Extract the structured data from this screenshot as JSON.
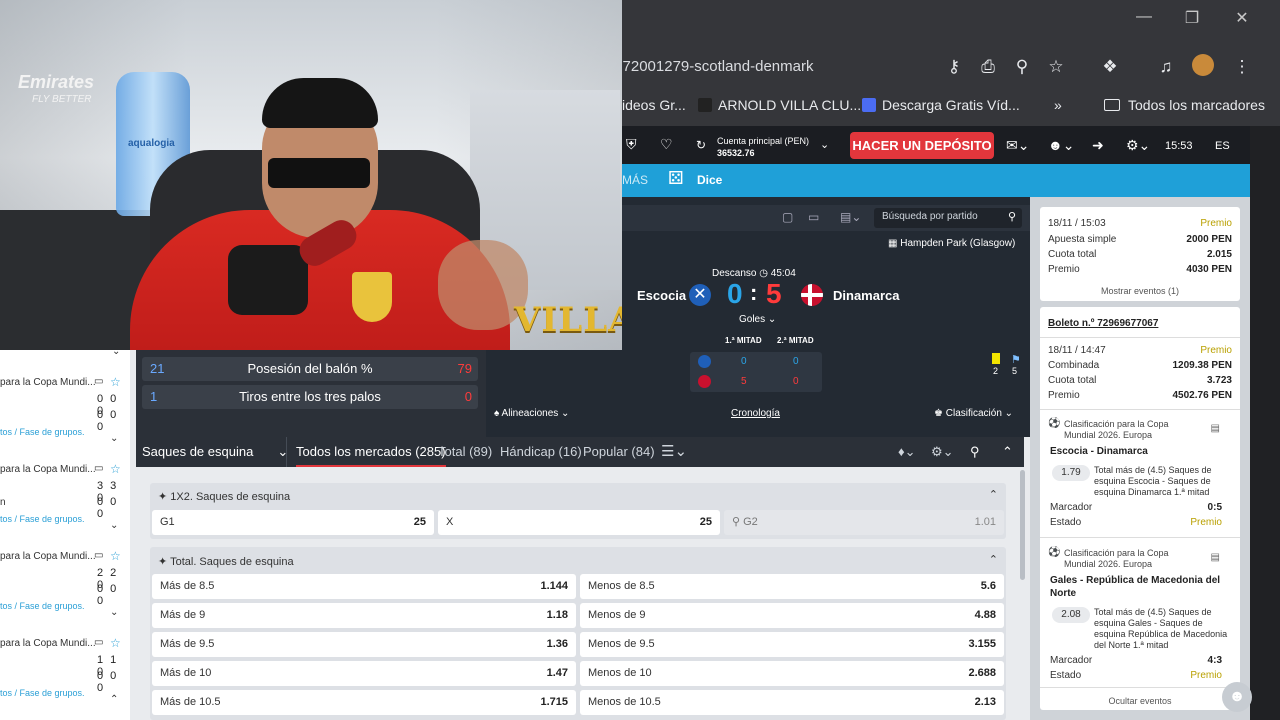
{
  "browser": {
    "url": "/672001279-scotland-denmark",
    "bookmarks": [
      "ideos Gr...",
      "ARNOLD VILLA CLU...",
      "Descarga Gratis Víd..."
    ],
    "bookmarks_folder": "Todos los marcadores"
  },
  "site_header": {
    "account_label": "Cuenta principal (PEN)",
    "balance": "36532.76",
    "deposit_label": "HACER UN DEPÓSITO",
    "time": "15:53",
    "lang": "ES",
    "nav_more": "MÁS",
    "nav_dice": "Dice"
  },
  "event": {
    "search_placeholder": "Búsqueda por partido",
    "venue": "Hampden Park (Glasgow)",
    "status": "Descanso",
    "clock": "45:04",
    "home_team": "Escocia",
    "away_team": "Dinamarca",
    "home_score": "0",
    "separator": ":",
    "away_score": "5",
    "goals_label": "Goles",
    "first_half": "1.ª MITAD",
    "second_half": "2.ª MITAD",
    "home_h1": "0",
    "home_h2": "0",
    "away_h1": "5",
    "away_h2": "0",
    "yellow_cards": "2",
    "corners": "5",
    "lineups": "Alineaciones",
    "timeline": "Cronología",
    "standings": "Clasificación"
  },
  "stats": [
    {
      "home": "21",
      "label": "Posesión del balón %",
      "away": "79"
    },
    {
      "home": "1",
      "label": "Tiros entre los tres palos",
      "away": "0"
    }
  ],
  "market_tabs": {
    "selector": "Saques de esquina",
    "all": "Todos los mercados (285)",
    "total": "Total (89)",
    "handicap": "Hándicap (16)",
    "popular": "Popular (84)"
  },
  "left_list": [
    {
      "title": "para la Copa Mundi...",
      "r1": "0 0 0",
      "r2": "0 0 0",
      "link": "tos / Fase de grupos."
    },
    {
      "title": "para la Copa Mundi...",
      "r1": "3 3 0",
      "r2": "0 0 0",
      "name": "n",
      "link": "tos / Fase de grupos."
    },
    {
      "title": "para la Copa Mundi...",
      "r1": "2 2 0",
      "r2": "0 0 0",
      "link": "tos / Fase de grupos."
    },
    {
      "title": "para la Copa Mundi...",
      "r1": "1 1 0",
      "r2": "0 0 0",
      "link": "tos / Fase de grupos."
    }
  ],
  "market_1x2": {
    "title": "1X2. Saques de esquina",
    "g1": "G1",
    "g1_odds": "25",
    "x": "X",
    "x_odds": "25",
    "g2": "G2",
    "g2_odds": "1.01"
  },
  "market_total": {
    "title": "Total. Saques de esquina",
    "rows": [
      {
        "over": "Más de 8.5",
        "over_odds": "1.144",
        "under": "Menos de 8.5",
        "under_odds": "5.6"
      },
      {
        "over": "Más de 9",
        "over_odds": "1.18",
        "under": "Menos de 9",
        "under_odds": "4.88"
      },
      {
        "over": "Más de 9.5",
        "over_odds": "1.36",
        "under": "Menos de 9.5",
        "under_odds": "3.155"
      },
      {
        "over": "Más de 10",
        "over_odds": "1.47",
        "under": "Menos de 10",
        "under_odds": "2.688"
      },
      {
        "over": "Más de 10.5",
        "over_odds": "1.715",
        "under": "Menos de 10.5",
        "under_odds": "2.13"
      }
    ]
  },
  "bets": {
    "bet1": {
      "date": "18/11 / 15:03",
      "status": "Premio",
      "type_label": "Apuesta simple",
      "type_value": "2000 PEN",
      "odds_label": "Cuota total",
      "odds_value": "2.015",
      "prize_label": "Premio",
      "prize_value": "4030 PEN",
      "show_events": "Mostrar eventos (1)"
    },
    "bet2": {
      "ticket": "Boleto n.º 72969677067",
      "date": "18/11 / 14:47",
      "status": "Premio",
      "type_label": "Combinada",
      "type_value": "1209.38 PEN",
      "odds_label": "Cuota total",
      "odds_value": "3.723",
      "prize_label": "Premio",
      "prize_value": "4502.76 PEN",
      "events": [
        {
          "competition": "Clasificación para la Copa Mundial 2026. Europa",
          "match": "Escocia - Dinamarca",
          "odds": "1.79",
          "pick": "Total más de (4.5) Saques de esquina Escocia - Saques de esquina Dinamarca 1.ª mitad",
          "score_label": "Marcador",
          "score": "0:5",
          "state_label": "Estado",
          "state": "Premio"
        },
        {
          "competition": "Clasificación para la Copa Mundial 2026. Europa",
          "match": "Gales - República de Macedonia del Norte",
          "odds": "2.08",
          "pick": "Total más de (4.5) Saques de esquina Gales - Saques de esquina República de Macedonia del Norte 1.ª mitad",
          "score_label": "Marcador",
          "score": "4:3",
          "state_label": "Estado",
          "state": "Premio"
        }
      ],
      "hide_events": "Ocultar eventos"
    }
  },
  "overlay": {
    "watermark": "VILLA",
    "banner": "Emirates",
    "banner_sub": "FLY BETTER",
    "bottle": "aqualogia"
  }
}
